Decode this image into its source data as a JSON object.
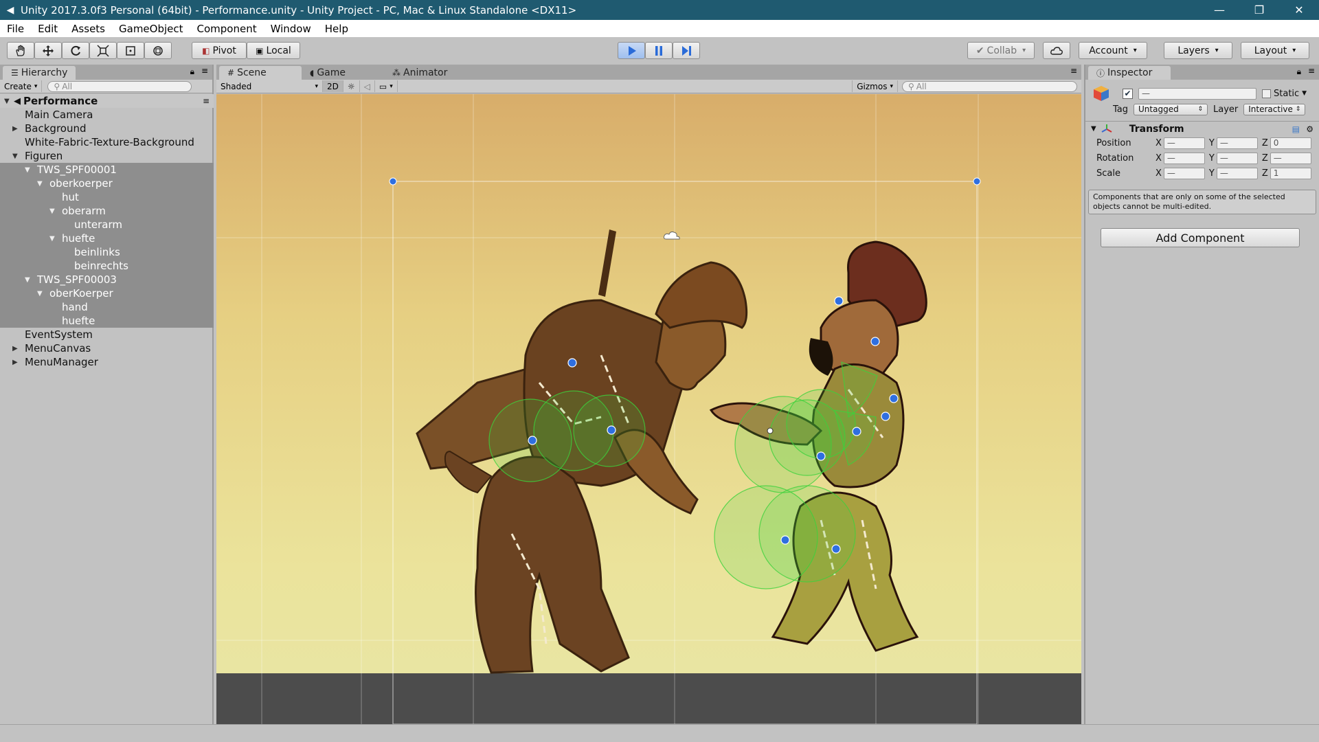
{
  "window": {
    "title": "Unity 2017.3.0f3 Personal (64bit) - Performance.unity - Unity Project - PC, Mac & Linux Standalone <DX11>",
    "controls": [
      "—",
      "❐",
      "✕"
    ]
  },
  "menubar": [
    "File",
    "Edit",
    "Assets",
    "GameObject",
    "Component",
    "Window",
    "Help"
  ],
  "toolbar": {
    "pivot_label": "Pivot",
    "local_label": "Local",
    "collab_label": "Collab",
    "account_label": "Account",
    "layers_label": "Layers",
    "layout_label": "Layout"
  },
  "hierarchy": {
    "tab": "Hierarchy",
    "create": "Create",
    "search_placeholder": "All",
    "root": "Performance",
    "items": [
      {
        "label": "Main Camera",
        "depth": 1,
        "arrow": "",
        "selected": false
      },
      {
        "label": "Background",
        "depth": 1,
        "arrow": "▶",
        "selected": false
      },
      {
        "label": "White-Fabric-Texture-Background",
        "depth": 1,
        "arrow": "",
        "selected": false
      },
      {
        "label": "Figuren",
        "depth": 1,
        "arrow": "▼",
        "selected": false
      },
      {
        "label": "TWS_SPF00001",
        "depth": 2,
        "arrow": "▼",
        "selected": true
      },
      {
        "label": "oberkoerper",
        "depth": 3,
        "arrow": "▼",
        "selected": true
      },
      {
        "label": "hut",
        "depth": 4,
        "arrow": "",
        "selected": true
      },
      {
        "label": "oberarm",
        "depth": 4,
        "arrow": "▼",
        "selected": true
      },
      {
        "label": "unterarm",
        "depth": 5,
        "arrow": "",
        "selected": true
      },
      {
        "label": "huefte",
        "depth": 4,
        "arrow": "▼",
        "selected": true
      },
      {
        "label": "beinlinks",
        "depth": 5,
        "arrow": "",
        "selected": true
      },
      {
        "label": "beinrechts",
        "depth": 5,
        "arrow": "",
        "selected": true
      },
      {
        "label": "TWS_SPF00003",
        "depth": 2,
        "arrow": "▼",
        "selected": true
      },
      {
        "label": "oberKoerper",
        "depth": 3,
        "arrow": "▼",
        "selected": true
      },
      {
        "label": "hand",
        "depth": 4,
        "arrow": "",
        "selected": true
      },
      {
        "label": "huefte",
        "depth": 4,
        "arrow": "",
        "selected": true
      },
      {
        "label": "EventSystem",
        "depth": 1,
        "arrow": "",
        "selected": false
      },
      {
        "label": "MenuCanvas",
        "depth": 1,
        "arrow": "▶",
        "selected": false
      },
      {
        "label": "MenuManager",
        "depth": 1,
        "arrow": "▶",
        "selected": false
      }
    ]
  },
  "scene": {
    "tabs": [
      "Scene",
      "Game",
      "Animator"
    ],
    "shading_mode": "Shaded",
    "mode_2d": "2D",
    "gizmos": "Gizmos",
    "search_placeholder": "All"
  },
  "inspector": {
    "tab": "Inspector",
    "name_value": "—",
    "static_label": "Static",
    "tag_label": "Tag",
    "tag_value": "Untagged",
    "layer_label": "Layer",
    "layer_value": "Interactive",
    "component_title": "Transform",
    "rows": [
      {
        "label": "Position",
        "x": "—",
        "y": "—",
        "z": "0"
      },
      {
        "label": "Rotation",
        "x": "—",
        "y": "—",
        "z": "—"
      },
      {
        "label": "Scale",
        "x": "—",
        "y": "—",
        "z": "1"
      }
    ],
    "help_text": "Components that are only on some of the selected objects cannot be multi-edited.",
    "add_component": "Add Component"
  },
  "colors": {
    "titlebar": "#1f5a70",
    "play_accent": "#2a6bd8",
    "selection": "#8e8e8e",
    "gizmo_green": "#3cd23c",
    "handle_blue": "#2f6fe0"
  }
}
